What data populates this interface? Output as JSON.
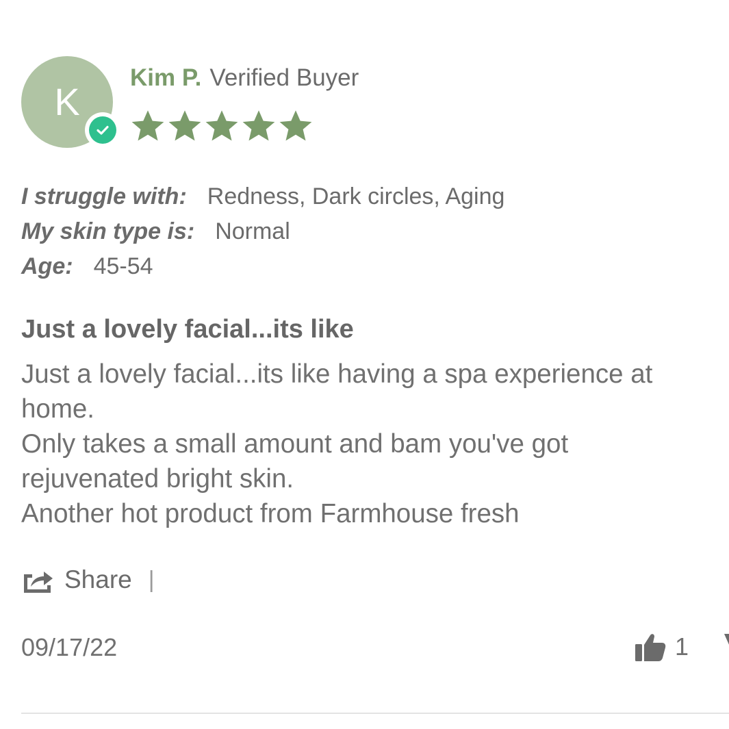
{
  "reviewer": {
    "initial": "K",
    "name": "Kim P.",
    "badge": "Verified Buyer",
    "avatar_color": "#b0c4a4",
    "name_color": "#7a9b6a",
    "verified_icon": "check-circle-icon"
  },
  "rating": {
    "value": 5,
    "max": 5,
    "star_color": "#7a9b6a"
  },
  "attributes": [
    {
      "label": "I struggle with:",
      "value": "Redness, Dark circles, Aging"
    },
    {
      "label": "My skin type is:",
      "value": "Normal"
    },
    {
      "label": "Age:",
      "value": "45-54"
    }
  ],
  "review": {
    "title": "Just a lovely facial...its like",
    "body_lines": [
      "Just a lovely facial...its like having a spa experience at",
      "home.",
      "Only takes a small amount and bam you've got",
      "rejuvenated bright skin.",
      "Another hot product from Farmhouse fresh"
    ]
  },
  "actions": {
    "share_label": "Share",
    "share_icon": "share-icon",
    "separator": "|"
  },
  "footer": {
    "date": "09/17/22",
    "thumbs_up_count": "1",
    "thumbs_up_icon": "thumbs-up-icon",
    "thumbs_down_icon": "thumbs-down-icon"
  }
}
